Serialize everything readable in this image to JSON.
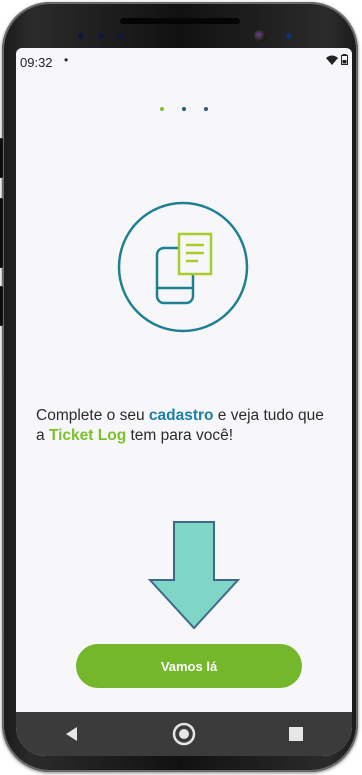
{
  "status_bar": {
    "time": "09:32",
    "dot": "•",
    "icons": [
      "wifi-icon",
      "battery-icon"
    ]
  },
  "pagination": {
    "total": 3,
    "active_index": 0
  },
  "illustration": {
    "icon": "phone-with-document-icon"
  },
  "message": {
    "part1": "Complete o seu ",
    "highlight1": "cadastro",
    "part2": " e veja tudo que a ",
    "highlight2": "Ticket Log",
    "part3": " tem para você!"
  },
  "cta": {
    "label": "Vamos lá"
  },
  "nav": {
    "items": [
      "back-icon",
      "home-icon",
      "recents-icon"
    ]
  },
  "colors": {
    "accent_green": "#74b72a",
    "teal": "#1c7fa6",
    "arrow_fill": "#7fd6c7"
  }
}
